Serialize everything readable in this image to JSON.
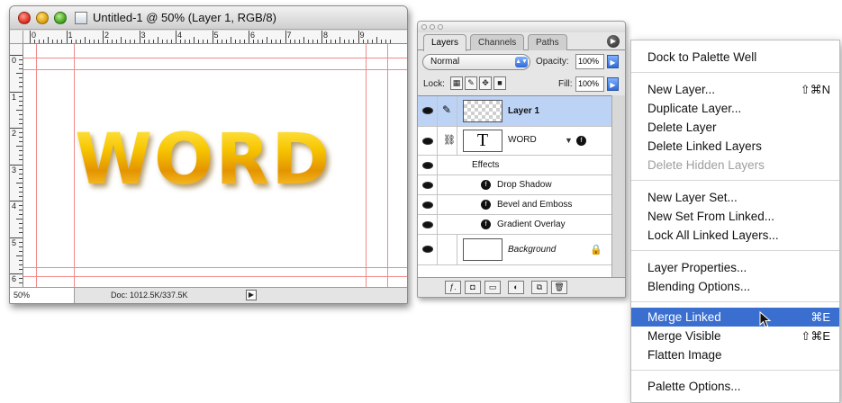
{
  "document_window": {
    "title": "Untitled-1 @ 50% (Layer 1, RGB/8)",
    "zoom": "50%",
    "doc_size": "Doc: 1012.5K/337.5K",
    "canvas_text": "WORD",
    "ruler_h_numbers": [
      "0",
      "1",
      "2",
      "3",
      "4",
      "5",
      "6",
      "7",
      "8",
      "9"
    ],
    "ruler_v_numbers": [
      "0",
      "1",
      "2",
      "3",
      "4",
      "5",
      "6"
    ]
  },
  "layers_palette": {
    "tabs": [
      "Layers",
      "Channels",
      "Paths"
    ],
    "blend_mode": "Normal",
    "opacity_label": "Opacity:",
    "opacity": "100%",
    "lock_label": "Lock:",
    "fill_label": "Fill:",
    "fill": "100%",
    "layers": {
      "layer1": "Layer 1",
      "word": "WORD",
      "effects": "Effects",
      "drop_shadow": "Drop Shadow",
      "bevel": "Bevel and Emboss",
      "gradient": "Gradient Overlay",
      "background": "Background"
    },
    "type_glyph": "T"
  },
  "flyout_menu": {
    "items": [
      {
        "label": "Dock to Palette Well",
        "shortcut": ""
      },
      {
        "label": "New Layer...",
        "shortcut": "⇧⌘N"
      },
      {
        "label": "Duplicate Layer...",
        "shortcut": ""
      },
      {
        "label": "Delete Layer",
        "shortcut": ""
      },
      {
        "label": "Delete Linked Layers",
        "shortcut": ""
      },
      {
        "label": "Delete Hidden Layers",
        "shortcut": "",
        "disabled": true
      },
      {
        "label": "New Layer Set...",
        "shortcut": ""
      },
      {
        "label": "New Set From Linked...",
        "shortcut": ""
      },
      {
        "label": "Lock All Linked Layers...",
        "shortcut": ""
      },
      {
        "label": "Layer Properties...",
        "shortcut": ""
      },
      {
        "label": "Blending Options...",
        "shortcut": ""
      },
      {
        "label": "Merge Linked",
        "shortcut": "⌘E",
        "highlighted": true
      },
      {
        "label": "Merge Visible",
        "shortcut": "⇧⌘E"
      },
      {
        "label": "Flatten Image",
        "shortcut": ""
      },
      {
        "label": "Palette Options...",
        "shortcut": ""
      }
    ]
  },
  "colors": {
    "highlight": "#3a6fd0",
    "selected_layer": "#bcd3f5",
    "guides": "#f08a8a",
    "word_gold": "#f7c500"
  }
}
